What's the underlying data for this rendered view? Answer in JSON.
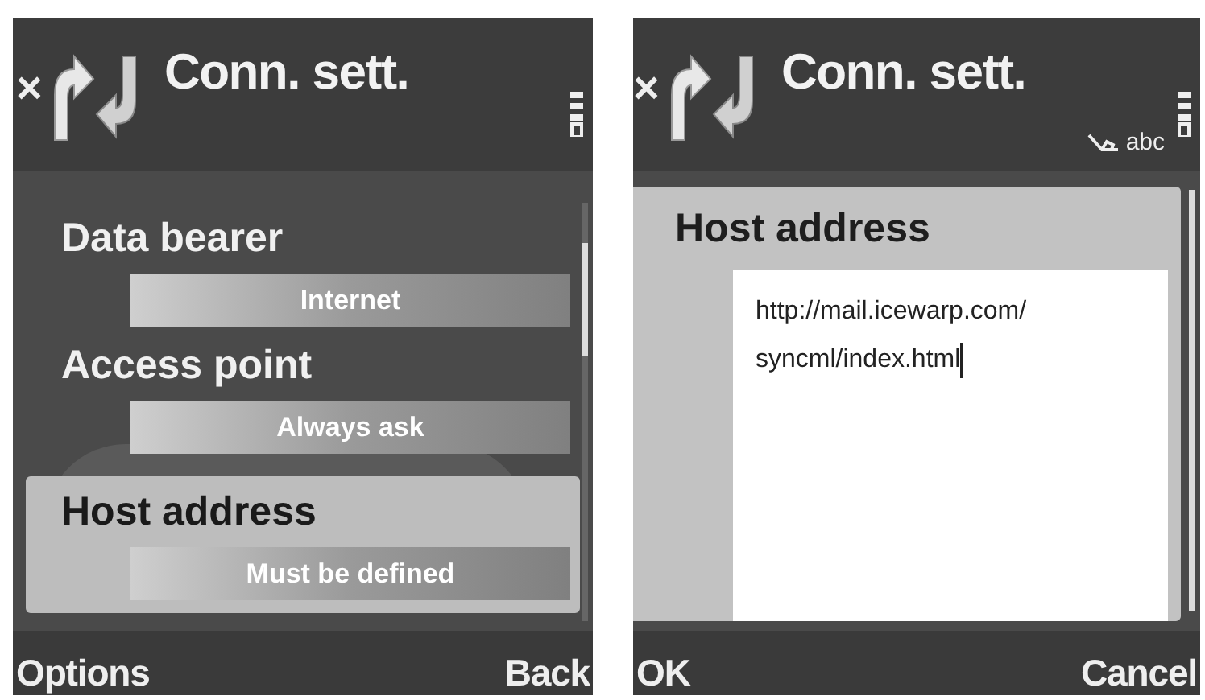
{
  "screens": [
    {
      "kind": "list",
      "close": "×",
      "title": "Conn. sett.",
      "settings": [
        {
          "label": "Data bearer",
          "value": "Internet",
          "selected": false
        },
        {
          "label": "Access point",
          "value": "Always ask",
          "selected": false
        },
        {
          "label": "Host address",
          "value": "Must be defined",
          "selected": true
        }
      ],
      "softkeys": {
        "left": "Options",
        "right": "Back"
      }
    },
    {
      "kind": "editor",
      "close": "×",
      "title": "Conn. sett.",
      "input_mode": "abc",
      "editor": {
        "label": "Host address",
        "lines": [
          "http://mail.icewarp.com/",
          "syncml/index.html"
        ],
        "caret": true
      },
      "softkeys": {
        "left": "OK",
        "right": "Cancel"
      }
    }
  ]
}
